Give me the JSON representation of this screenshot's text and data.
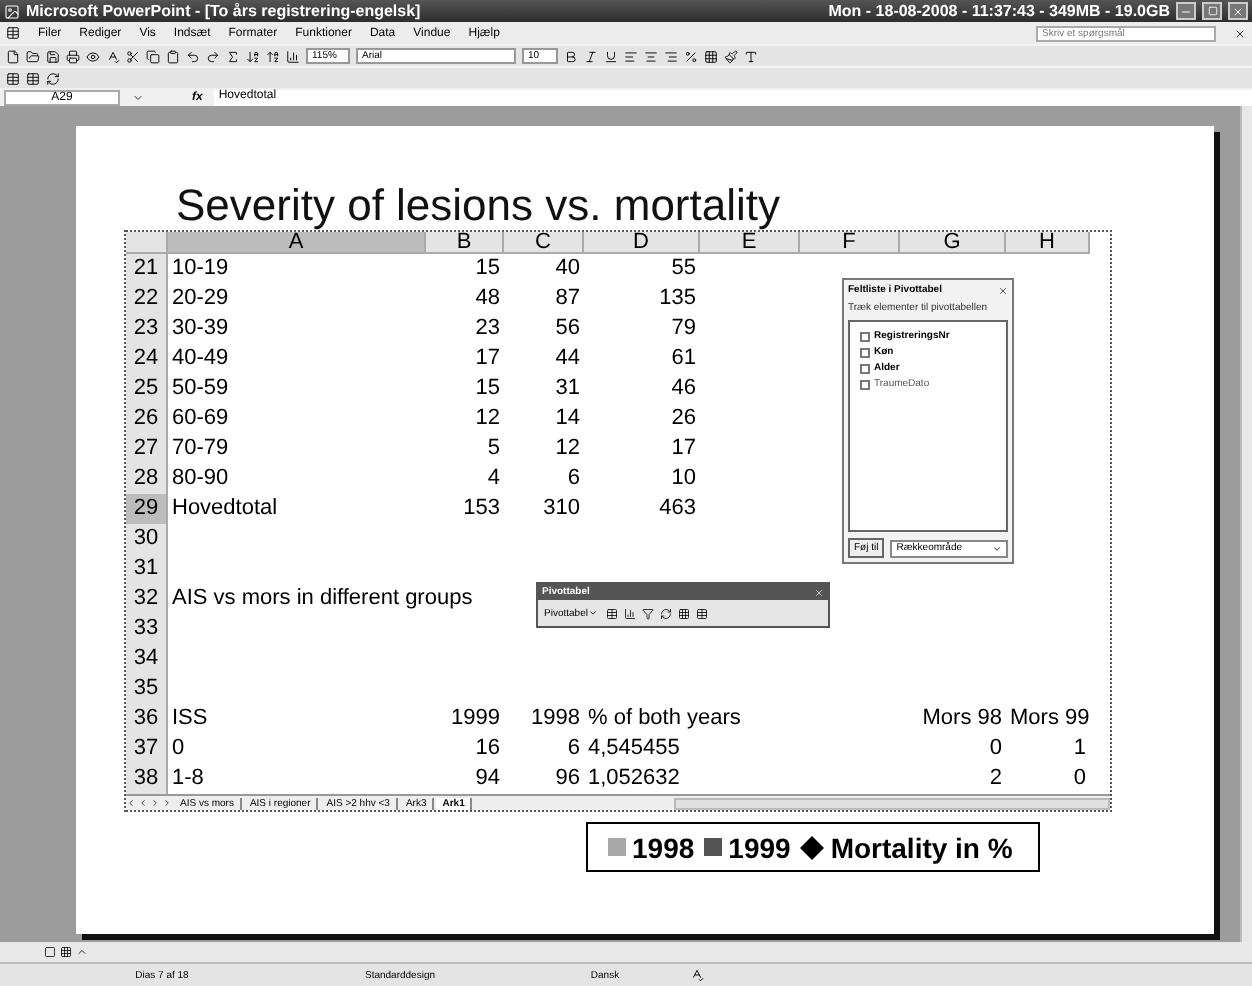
{
  "window": {
    "title": "Microsoft PowerPoint - [To års registrering-engelsk]",
    "status_info": "Mon - 18-08-2008 - 11:37:43 - 349MB - 19.0GB"
  },
  "menu": [
    "Filer",
    "Rediger",
    "Vis",
    "Indsæt",
    "Formater",
    "Funktioner",
    "Data",
    "Vindue",
    "Hjælp"
  ],
  "help_box": {
    "placeholder": "Skriv et spørgsmål"
  },
  "toolbar": {
    "zoom": "115%",
    "font": "Arial",
    "size": "10"
  },
  "formula_bar": {
    "cell": "A29",
    "fx": "fx",
    "value": "Hovedtotal"
  },
  "slide": {
    "title": "Severity of lesions vs. mortality",
    "sheet": {
      "columns": [
        {
          "label": "A",
          "selected": true
        },
        {
          "label": "B",
          "selected": false
        },
        {
          "label": "C",
          "selected": false
        },
        {
          "label": "D",
          "selected": false
        },
        {
          "label": "E",
          "selected": false
        },
        {
          "label": "F",
          "selected": false
        },
        {
          "label": "G",
          "selected": false
        },
        {
          "label": "H",
          "selected": false
        }
      ],
      "rows": [
        {
          "number": "21",
          "selected": false,
          "cells": [
            {
              "text": "10-19",
              "kind": "text"
            },
            {
              "text": "15",
              "kind": "number"
            },
            {
              "text": "40",
              "kind": "number"
            },
            {
              "text": "55",
              "kind": "number"
            },
            {
              "kind": "empty"
            },
            {
              "kind": "empty"
            },
            {
              "kind": "empty"
            },
            {
              "kind": "empty"
            }
          ]
        },
        {
          "number": "22",
          "selected": false,
          "cells": [
            {
              "text": "20-29",
              "kind": "text"
            },
            {
              "text": "48",
              "kind": "number"
            },
            {
              "text": "87",
              "kind": "number"
            },
            {
              "text": "135",
              "kind": "number"
            },
            {
              "kind": "empty"
            },
            {
              "kind": "empty"
            },
            {
              "kind": "empty"
            },
            {
              "kind": "empty"
            }
          ]
        },
        {
          "number": "23",
          "selected": false,
          "cells": [
            {
              "text": "30-39",
              "kind": "text"
            },
            {
              "text": "23",
              "kind": "number"
            },
            {
              "text": "56",
              "kind": "number"
            },
            {
              "text": "79",
              "kind": "number"
            },
            {
              "kind": "empty"
            },
            {
              "kind": "empty"
            },
            {
              "kind": "empty"
            },
            {
              "kind": "empty"
            }
          ]
        },
        {
          "number": "24",
          "selected": false,
          "cells": [
            {
              "text": "40-49",
              "kind": "text"
            },
            {
              "text": "17",
              "kind": "number"
            },
            {
              "text": "44",
              "kind": "number"
            },
            {
              "text": "61",
              "kind": "number"
            },
            {
              "kind": "empty"
            },
            {
              "kind": "empty"
            },
            {
              "kind": "empty"
            },
            {
              "kind": "empty"
            }
          ]
        },
        {
          "number": "25",
          "selected": false,
          "cells": [
            {
              "text": "50-59",
              "kind": "text"
            },
            {
              "text": "15",
              "kind": "number"
            },
            {
              "text": "31",
              "kind": "number"
            },
            {
              "text": "46",
              "kind": "number"
            },
            {
              "kind": "empty"
            },
            {
              "kind": "empty"
            },
            {
              "kind": "empty"
            },
            {
              "kind": "empty"
            }
          ]
        },
        {
          "number": "26",
          "selected": false,
          "cells": [
            {
              "text": "60-69",
              "kind": "text"
            },
            {
              "text": "12",
              "kind": "number"
            },
            {
              "text": "14",
              "kind": "number"
            },
            {
              "text": "26",
              "kind": "number"
            },
            {
              "kind": "empty"
            },
            {
              "kind": "empty"
            },
            {
              "kind": "empty"
            },
            {
              "kind": "empty"
            }
          ]
        },
        {
          "number": "27",
          "selected": false,
          "cells": [
            {
              "text": "70-79",
              "kind": "text"
            },
            {
              "text": "5",
              "kind": "number"
            },
            {
              "text": "12",
              "kind": "number"
            },
            {
              "text": "17",
              "kind": "number"
            },
            {
              "kind": "empty"
            },
            {
              "kind": "empty"
            },
            {
              "kind": "empty"
            },
            {
              "kind": "empty"
            }
          ]
        },
        {
          "number": "28",
          "selected": false,
          "cells": [
            {
              "text": "80-90",
              "kind": "text"
            },
            {
              "text": "4",
              "kind": "number"
            },
            {
              "text": "6",
              "kind": "number"
            },
            {
              "text": "10",
              "kind": "number"
            },
            {
              "kind": "empty"
            },
            {
              "kind": "empty"
            },
            {
              "kind": "empty"
            },
            {
              "kind": "empty"
            }
          ]
        },
        {
          "number": "29",
          "selected": true,
          "cells": [
            {
              "text": "Hovedtotal",
              "kind": "text"
            },
            {
              "text": "153",
              "kind": "number"
            },
            {
              "text": "310",
              "kind": "number"
            },
            {
              "text": "463",
              "kind": "number"
            },
            {
              "kind": "empty"
            },
            {
              "kind": "empty"
            },
            {
              "kind": "empty"
            },
            {
              "kind": "empty"
            }
          ]
        },
        {
          "number": "30",
          "selected": false,
          "cells": [
            {
              "kind": "empty"
            },
            {
              "kind": "empty"
            },
            {
              "kind": "empty"
            },
            {
              "kind": "empty"
            },
            {
              "kind": "empty"
            },
            {
              "kind": "empty"
            },
            {
              "kind": "empty"
            },
            {
              "kind": "empty"
            }
          ]
        },
        {
          "number": "31",
          "selected": false,
          "cells": [
            {
              "kind": "empty"
            },
            {
              "kind": "empty"
            },
            {
              "kind": "empty"
            },
            {
              "kind": "empty"
            },
            {
              "kind": "empty"
            },
            {
              "kind": "empty"
            },
            {
              "kind": "empty"
            },
            {
              "kind": "empty"
            }
          ]
        },
        {
          "number": "32",
          "selected": false,
          "cells": [
            {
              "text": "AIS vs mors in different groups",
              "kind": "text"
            },
            {
              "kind": "empty"
            },
            {
              "kind": "empty"
            },
            {
              "kind": "empty"
            },
            {
              "kind": "empty"
            },
            {
              "kind": "empty"
            },
            {
              "kind": "empty"
            },
            {
              "kind": "empty"
            }
          ]
        },
        {
          "number": "33",
          "selected": false,
          "cells": [
            {
              "kind": "empty"
            },
            {
              "kind": "empty"
            },
            {
              "kind": "empty"
            },
            {
              "kind": "empty"
            },
            {
              "kind": "empty"
            },
            {
              "kind": "empty"
            },
            {
              "kind": "empty"
            },
            {
              "kind": "empty"
            }
          ]
        },
        {
          "number": "34",
          "selected": false,
          "cells": [
            {
              "kind": "empty"
            },
            {
              "kind": "empty"
            },
            {
              "kind": "empty"
            },
            {
              "kind": "empty"
            },
            {
              "kind": "empty"
            },
            {
              "kind": "empty"
            },
            {
              "kind": "empty"
            },
            {
              "kind": "empty"
            }
          ]
        },
        {
          "number": "35",
          "selected": false,
          "cells": [
            {
              "kind": "empty"
            },
            {
              "kind": "empty"
            },
            {
              "kind": "empty"
            },
            {
              "kind": "empty"
            },
            {
              "kind": "empty"
            },
            {
              "kind": "empty"
            },
            {
              "kind": "empty"
            },
            {
              "kind": "empty"
            }
          ]
        },
        {
          "number": "36",
          "selected": false,
          "cells": [
            {
              "text": "ISS",
              "kind": "text"
            },
            {
              "text": "1999",
              "kind": "number"
            },
            {
              "text": "1998",
              "kind": "number"
            },
            {
              "text": "% of both years",
              "kind": "text"
            },
            {
              "kind": "empty"
            },
            {
              "kind": "empty"
            },
            {
              "text": "Mors 98",
              "kind": "number"
            },
            {
              "text": "Mors 99",
              "kind": "number"
            }
          ]
        },
        {
          "number": "37",
          "selected": false,
          "cells": [
            {
              "text": "0",
              "kind": "text"
            },
            {
              "text": "16",
              "kind": "number"
            },
            {
              "text": "6",
              "kind": "number"
            },
            {
              "text": "4,545455",
              "kind": "text"
            },
            {
              "kind": "empty"
            },
            {
              "kind": "empty"
            },
            {
              "text": "0",
              "kind": "number"
            },
            {
              "text": "1",
              "kind": "number"
            }
          ]
        },
        {
          "number": "38",
          "selected": false,
          "cells": [
            {
              "text": "1-8",
              "kind": "text"
            },
            {
              "text": "94",
              "kind": "number"
            },
            {
              "text": "96",
              "kind": "number"
            },
            {
              "text": "1,052632",
              "kind": "text"
            },
            {
              "kind": "empty"
            },
            {
              "kind": "empty"
            },
            {
              "text": "2",
              "kind": "number"
            },
            {
              "text": "0",
              "kind": "number"
            }
          ]
        }
      ],
      "tabs": [
        {
          "label": "AIS vs mors",
          "selected": false
        },
        {
          "label": "AIS i regioner",
          "selected": false
        },
        {
          "label": "AIS >2 hhv <3",
          "selected": false
        },
        {
          "label": "Ark3",
          "selected": false
        },
        {
          "label": "Ark1",
          "selected": true
        }
      ]
    },
    "field_list": {
      "title": "Feltliste i Pivottabel",
      "hint": "Træk elementer til pivottabellen",
      "fields": [
        {
          "label": "RegistreringsNr",
          "used": true
        },
        {
          "label": "Køn",
          "used": true
        },
        {
          "label": "Alder",
          "used": true
        },
        {
          "label": "TraumeDato",
          "used": false
        }
      ],
      "add_button": "Føj til",
      "area": "Rækkeområde"
    },
    "pivot_toolbar": {
      "title": "Pivottabel",
      "menu": "Pivottabel"
    },
    "legend": [
      {
        "label": "1998",
        "kind": "square",
        "color": "#a8a8a8"
      },
      {
        "label": "1999",
        "kind": "square",
        "color": "#555555"
      },
      {
        "label": "Mortality in %",
        "kind": "diamond",
        "color": "#000000"
      }
    ]
  },
  "status_bar": [
    "Dias 7 af 18",
    "Standarddesign",
    "Dansk"
  ]
}
